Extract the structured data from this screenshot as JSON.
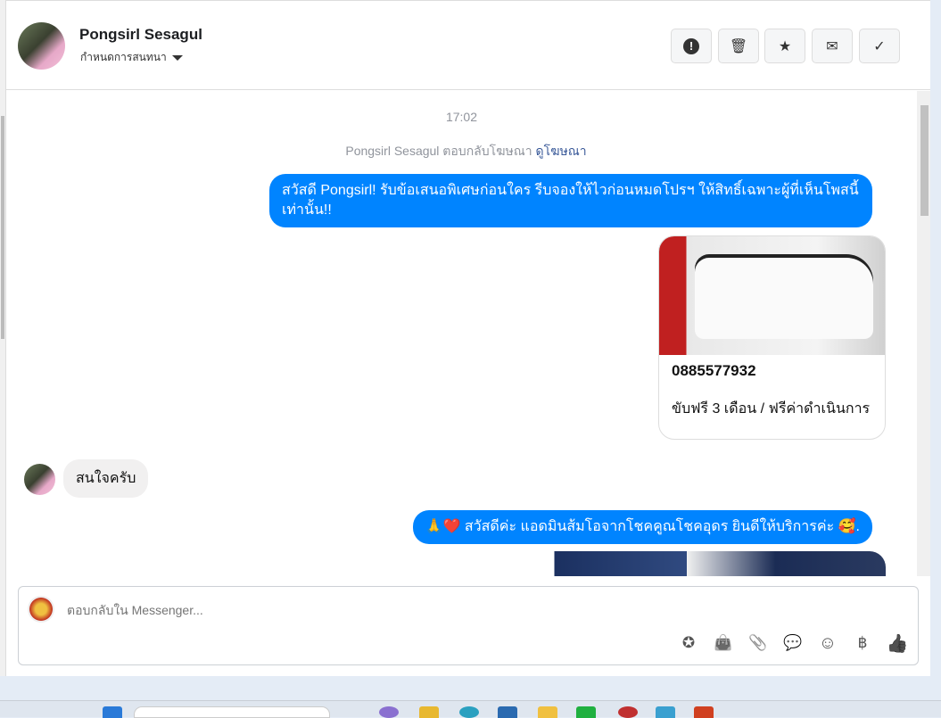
{
  "header": {
    "name": "Pongsirl Sesagul",
    "subtitle": "กำหนดการสนทนา",
    "buttons": [
      {
        "name": "spam-button",
        "icon": "!"
      },
      {
        "name": "delete-button",
        "icon": "🗑"
      },
      {
        "name": "star-button",
        "icon": "★"
      },
      {
        "name": "mark-unread-button",
        "icon": "✉"
      },
      {
        "name": "done-button",
        "icon": "✓"
      }
    ]
  },
  "chat": {
    "time": "17:02",
    "reply_notice": "Pongsirl Sesagul ตอบกลับโฆษณา",
    "view_ad": "ดูโฆษณา",
    "msg1": "สวัสดี Pongsirl! รับข้อเสนอพิเศษก่อนใคร รีบจองให้ไวก่อนหมดโปรฯ ให้สิทธิ์เฉพาะผู้ที่เห็นโพสนี้เท่านั้น!!",
    "card_phone": "0885577932",
    "card_desc": "ขับฟรี 3 เดือน / ฟรีค่าดำเนินการ",
    "msg_in": "สนใจครับ",
    "msg2": "🙏❤️ สวัสดีค่ะ แอดมินส้มโอจากโชคคูณโชคอุดร ยินดีให้บริการค่ะ 🥰."
  },
  "composer": {
    "placeholder": "ตอบกลับใน Messenger...",
    "tools": [
      {
        "name": "saved-reply-icon",
        "glyph": "✪"
      },
      {
        "name": "shop-bag-icon",
        "glyph": "👜"
      },
      {
        "name": "attach-icon",
        "glyph": "📎"
      },
      {
        "name": "quick-reply-icon",
        "glyph": "💬"
      },
      {
        "name": "emoji-icon",
        "glyph": "☺"
      },
      {
        "name": "payment-icon",
        "glyph": "฿"
      },
      {
        "name": "like-icon",
        "glyph": "👍"
      }
    ]
  }
}
